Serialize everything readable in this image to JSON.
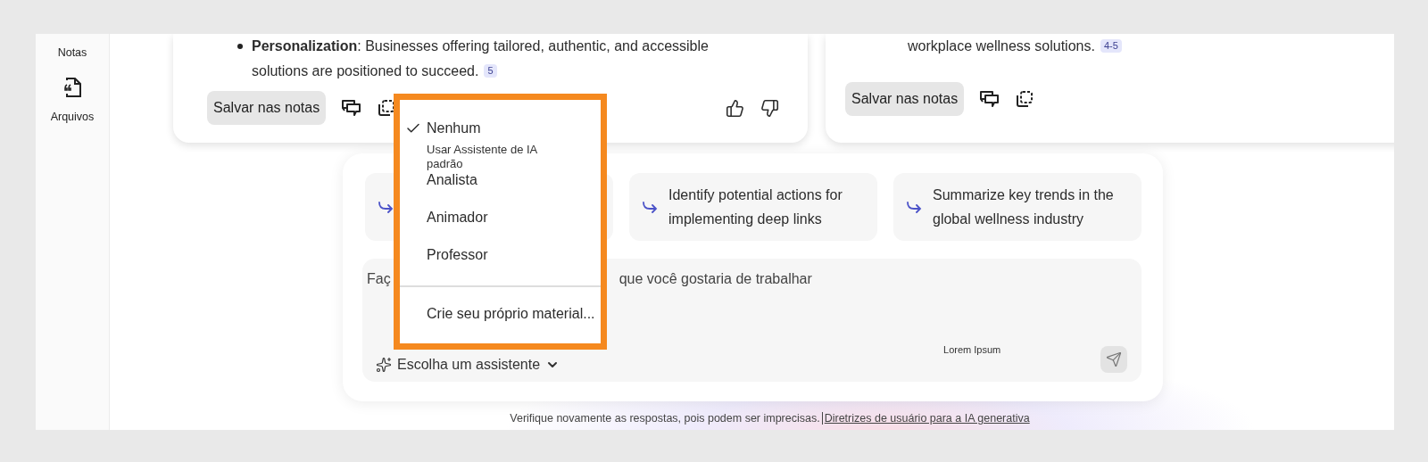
{
  "sidebar": {
    "items": [
      {
        "kind": "label",
        "label": "Notas"
      },
      {
        "kind": "file",
        "label": "Arquivos"
      }
    ]
  },
  "cards": [
    {
      "bullets": [
        {
          "text": "**Personalization**: Businesses offering tailored, authentic, and accessible solutions are positioned to succeed.",
          "citation": "5"
        }
      ],
      "save_label": "Salvar nas notas",
      "feedback": true
    },
    {
      "bullets": [
        {
          "text": "workplace wellness solutions.",
          "citation": "4-5"
        }
      ],
      "save_label": "Salvar nas notas",
      "feedback": false
    }
  ],
  "composer": {
    "suggestions": [
      {
        "kind": "covered"
      },
      {
        "kind": "prompt",
        "text": "Identify potential actions for implementing deep links"
      },
      {
        "kind": "prompt",
        "text": "Summarize key trends in the global wellness industry"
      }
    ],
    "input": {
      "placeholder_start": "Faç",
      "placeholder_end": "que você gostaria de trabalhar",
      "hint": "Lorem Ipsum"
    },
    "assistant_label": "Escolha um assistente"
  },
  "assistant_menu": {
    "items": [
      {
        "kind": "option",
        "label": "Nenhum",
        "description": "Usar Assistente de IA padrão",
        "selected": true
      },
      {
        "kind": "option",
        "label": "Analista",
        "selected": false
      },
      {
        "kind": "option",
        "label": "Animador",
        "selected": false
      },
      {
        "kind": "option",
        "label": "Professor",
        "selected": false
      },
      {
        "kind": "action",
        "label": "Crie seu próprio material..."
      }
    ]
  },
  "footer": {
    "disclaimer": "Verifique novamente as respostas, pois podem ser imprecisas.",
    "link": "Diretrizes de usuário para a IA generativa"
  }
}
